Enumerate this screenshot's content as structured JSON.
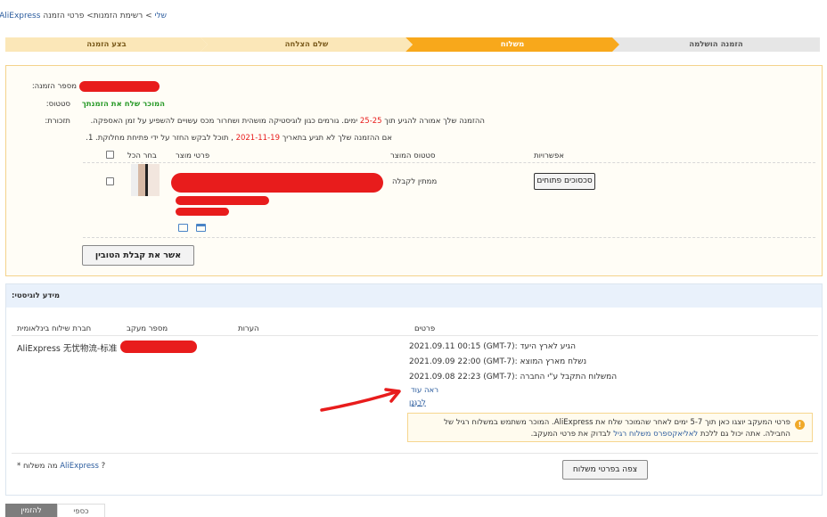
{
  "breadcrumb": {
    "home": "שלי",
    "sep": ">",
    "orders": "רשימת הזמנות",
    "current": "פרטי הזמנה",
    "site": "AliExpress"
  },
  "steps": [
    {
      "label": "בצע הזמנה",
      "state": "done"
    },
    {
      "label": "שלם הצלחה",
      "state": "done"
    },
    {
      "label": "משלוח",
      "state": "current"
    },
    {
      "label": "הזמנה הושלמה",
      "state": "future"
    }
  ],
  "order": {
    "order_number_label": "מספר הזמנה:",
    "status_label": "סטטוס:",
    "status_value": "המוכר שלח את הזמנתך",
    "reminder_label": "תזכורת:",
    "reminder_line1_pre": "ההזמנה שלך אמורה להגיע תוך",
    "reminder_days": "25-25",
    "reminder_line1_post": "ימים. גורמים כגון לוגיסטיקה מושהית ושחרור מכס עשויים להשפיע על זמן האספקה.",
    "reminder_line2_pre": "אם ההזמנה שלך לא תגיע בתאריך",
    "reminder_date": "2021-11-19",
    "reminder_line2_post": ", תוכל לבקש החזר על ידי פתיחת מחלוקת. 1.",
    "col_select_all": "בחר הכל",
    "col_product": "פרטי מוצר",
    "col_status": "סטטוס המוצר",
    "col_options": "אפשרויות",
    "item_status": "ממתין לקבלה",
    "disputes_button": "סכסוכים פתוחים",
    "confirm_button": "אשר את קבלת הטובין"
  },
  "logistics": {
    "title": "מידע לוגיסטי:",
    "col_carrier": "חברת שילוח בינלאומית",
    "col_tracking": "מספר מעקב",
    "col_notes": "הערות",
    "col_details": "פרטים",
    "carrier_name": "AliExpress 无忧物流-标准",
    "events": [
      {
        "time": "2021.09.11 00:15 (GMT-7):",
        "text": "הגיע לארץ היעד"
      },
      {
        "time": "2021.09.09 22:00 (GMT-7):",
        "text": "נשלח מארץ המוצא"
      },
      {
        "time": "2021.09.08 22:23 (GMT-7):",
        "text": "המשלוח התקבל ע\"י החברה"
      }
    ],
    "see_more": "ראה עוד",
    "collapse": "לְרַגְּנַן",
    "tip_line1": "פרטי המעקב יוצגו כאן תוך 5-7 ימים לאחר שהמוכר שלח את AliExpress. המוכר משתמש במשלוח רגיל של",
    "tip_line2_pre": "החבילה. אתה יכול גם ללכת",
    "tip_link": "לאליאקספרס משלוח רגיל",
    "tip_line2_post": "לבדוק את פרטי המעקב.",
    "what_is": "* מה משלוח",
    "what_is_link": "AliExpress",
    "what_is_q": "?",
    "view_button": "צפה בפרטי משלוח"
  },
  "tabs": [
    {
      "label": "להזמין",
      "active": true
    },
    {
      "label": "כספי",
      "active": false
    }
  ],
  "colors": {
    "accent": "#f8a81b",
    "link": "#2b5c9e",
    "danger": "#e81c1c",
    "success": "#2a9b2a"
  }
}
